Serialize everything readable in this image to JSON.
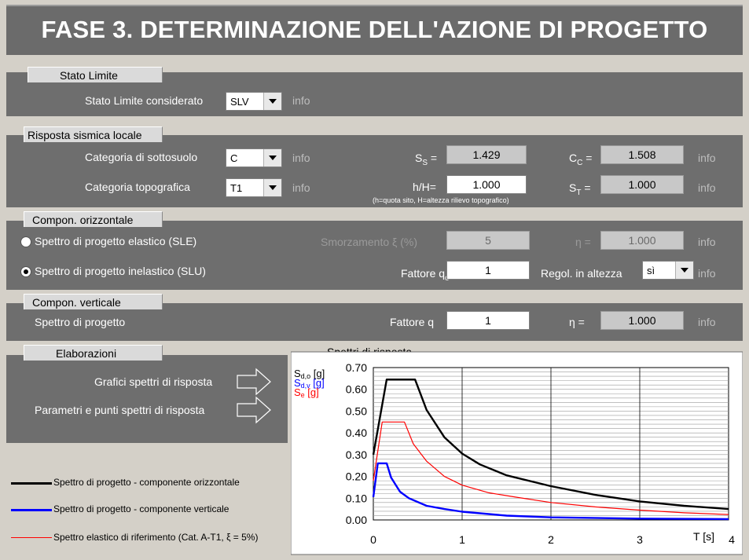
{
  "title": "FASE 3. DETERMINAZIONE DELL'AZIONE DI PROGETTO",
  "stato_limite": {
    "section": "Stato Limite",
    "label": "Stato Limite considerato",
    "value": "SLV",
    "info": "info"
  },
  "risposta": {
    "section": "Risposta sismica locale",
    "sottosuolo_label": "Categoria di sottosuolo",
    "sottosuolo_value": "C",
    "topografica_label": "Categoria topografica",
    "topografica_value": "T1",
    "info": "info",
    "ss_label": "S",
    "ss_sub": "S",
    "ss_value": "1.429",
    "cc_label": "C",
    "cc_sub": "C",
    "cc_value": "1.508",
    "hH_label": "h/H=",
    "hH_value": "1.000",
    "hH_note": "(h=quota sito, H=altezza rilievo topografico)",
    "st_label": "S",
    "st_sub": "T",
    "st_value": "1.000"
  },
  "orizzontale": {
    "section": "Compon. orizzontale",
    "sle_label": "Spettro di progetto elastico (SLE)",
    "slu_label": "Spettro di progetto inelastico (SLU)",
    "smorz_label": "Smorzamento",
    "smorz_symbol": "ξ",
    "smorz_unit": "(%)",
    "smorz_value": "5",
    "eta_label": "η =",
    "eta_value": "1.000",
    "fattore_label": "Fattore q",
    "fattore_sub": "o",
    "fattore_value": "1",
    "regol_label": "Regol. in altezza",
    "regol_value": "sì",
    "info": "info"
  },
  "verticale": {
    "section": "Compon. verticale",
    "spettro_label": "Spettro di progetto",
    "fattore_label": "Fattore q",
    "fattore_value": "1",
    "eta_label": "η =",
    "eta_value": "1.000",
    "info": "info"
  },
  "elaborazioni": {
    "section": "Elaborazioni",
    "grafici_label": "Grafici spettri di risposta",
    "parametri_label": "Parametri e punti spettri di risposta"
  },
  "legend": {
    "items": [
      {
        "label": "Spettro di progetto - componente orizzontale",
        "color": "#000000"
      },
      {
        "label": "Spettro di progetto - componente verticale",
        "color": "#0000ff"
      },
      {
        "label": "Spettro elastico di riferimento (Cat. A-T1, ξ = 5%)",
        "color": "#ff0000"
      }
    ]
  },
  "chart_data": {
    "type": "line",
    "title": "Spettri di risposta",
    "xlabel": "T [s]",
    "ylabels": [
      {
        "text": "S",
        "sub": "d,o",
        "unit": " [g]",
        "color": "#000000"
      },
      {
        "text": "S",
        "sub": "d,v",
        "unit": " [g]",
        "color": "#0000ff"
      },
      {
        "text": "S",
        "sub": "e",
        "unit": " [g]",
        "color": "#ff0000"
      }
    ],
    "xlim": [
      0,
      4
    ],
    "ylim": [
      0,
      0.7
    ],
    "xticks": [
      0,
      1,
      2,
      3,
      4
    ],
    "yticks": [
      "0.00",
      "0.10",
      "0.20",
      "0.30",
      "0.40",
      "0.50",
      "0.60",
      "0.70"
    ],
    "grid": true,
    "series": [
      {
        "color": "#000000",
        "x": [
          0,
          0.15,
          0.47,
          0.6,
          0.8,
          1.0,
          1.2,
          1.5,
          2.0,
          2.5,
          3.0,
          3.5,
          4.0
        ],
        "y": [
          0.3,
          0.645,
          0.645,
          0.505,
          0.38,
          0.305,
          0.255,
          0.205,
          0.155,
          0.115,
          0.085,
          0.065,
          0.05
        ]
      },
      {
        "color": "#0000ff",
        "x": [
          0,
          0.05,
          0.15,
          0.2,
          0.3,
          0.4,
          0.6,
          0.8,
          1.0,
          1.5,
          2.0,
          3.0,
          4.0
        ],
        "y": [
          0.105,
          0.26,
          0.26,
          0.195,
          0.13,
          0.1,
          0.065,
          0.05,
          0.038,
          0.02,
          0.012,
          0.006,
          0.004
        ]
      },
      {
        "color": "#ff0000",
        "x": [
          0,
          0.1,
          0.35,
          0.45,
          0.6,
          0.8,
          1.0,
          1.3,
          1.6,
          2.0,
          2.5,
          3.0,
          3.5,
          4.0
        ],
        "y": [
          0.18,
          0.45,
          0.45,
          0.35,
          0.27,
          0.2,
          0.16,
          0.125,
          0.105,
          0.08,
          0.06,
          0.045,
          0.033,
          0.025
        ]
      }
    ]
  }
}
